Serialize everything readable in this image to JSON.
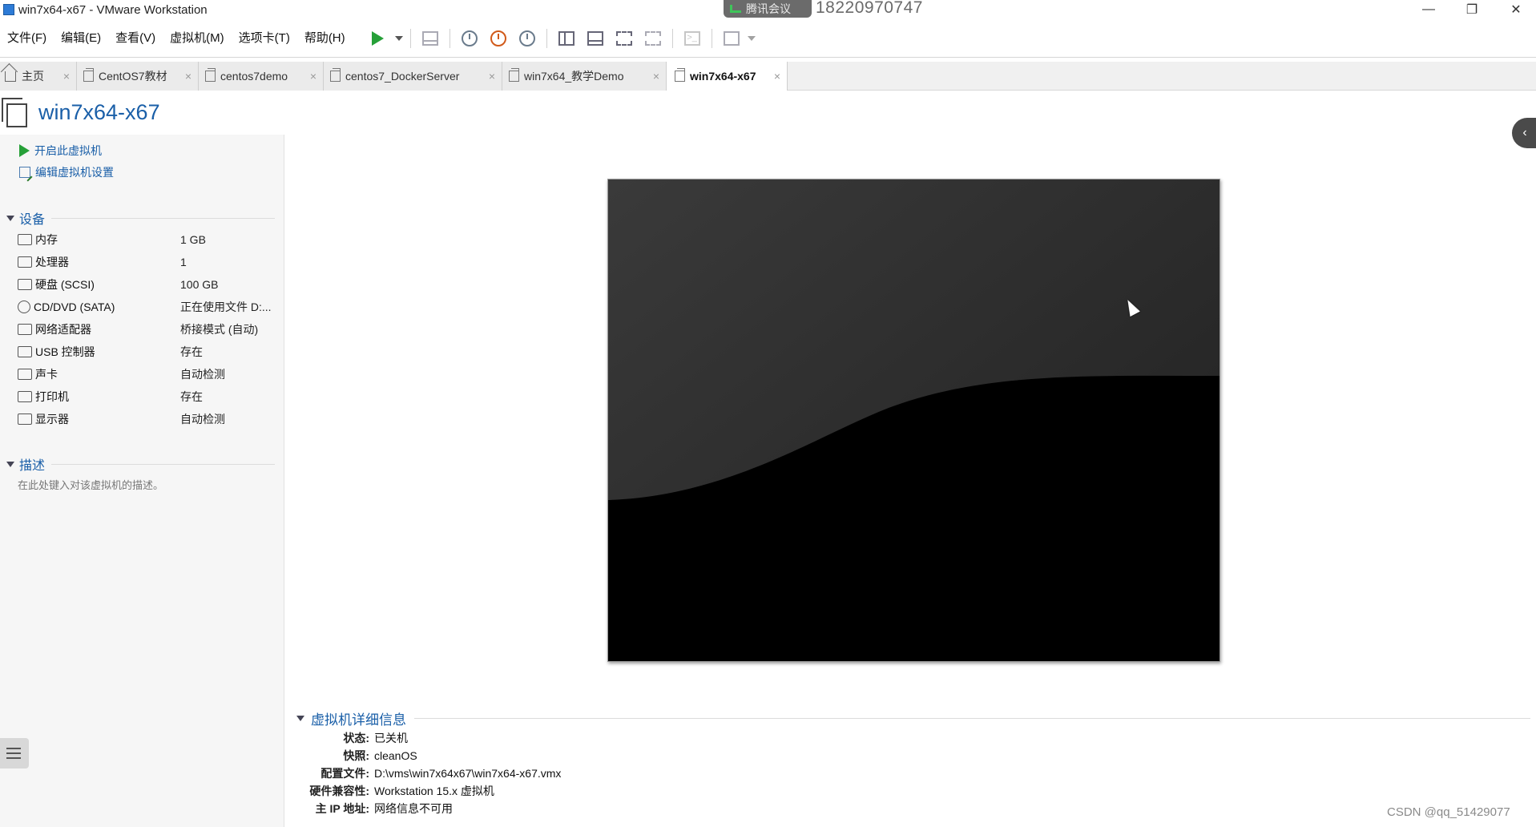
{
  "window": {
    "title": "win7x64-x67 - VMware Workstation",
    "meeting_badge": "腾讯会议",
    "meeting_number": "18220970747",
    "minimize": "—",
    "restore": "❐",
    "close": "✕"
  },
  "menu": [
    "文件(F)",
    "编辑(E)",
    "查看(V)",
    "虚拟机(M)",
    "选项卡(T)",
    "帮助(H)"
  ],
  "tabs": [
    {
      "label": "主页",
      "icon": "home-icon",
      "active": false
    },
    {
      "label": "CentOS7教材",
      "icon": "vm-icon",
      "active": false
    },
    {
      "label": "centos7demo",
      "icon": "vm-icon",
      "active": false
    },
    {
      "label": "centos7_DockerServer",
      "icon": "vm-icon",
      "active": false
    },
    {
      "label": "win7x64_教学Demo",
      "icon": "vm-icon",
      "active": false
    },
    {
      "label": "win7x64-x67",
      "icon": "vm-icon",
      "active": true
    }
  ],
  "tab_close": "×",
  "vm": {
    "title": "win7x64-x67",
    "actions": {
      "power_on": "开启此虚拟机",
      "edit_settings": "编辑虚拟机设置"
    }
  },
  "devices": {
    "heading": "设备",
    "items": [
      {
        "name": "内存",
        "value": "1 GB",
        "icon": "memory-icon"
      },
      {
        "name": "处理器",
        "value": "1",
        "icon": "cpu-icon"
      },
      {
        "name": "硬盘 (SCSI)",
        "value": "100 GB",
        "icon": "hard-disk-icon"
      },
      {
        "name": "CD/DVD (SATA)",
        "value": "正在使用文件 D:...",
        "icon": "cd-dvd-icon"
      },
      {
        "name": "网络适配器",
        "value": "桥接模式 (自动)",
        "icon": "network-adapter-icon"
      },
      {
        "name": "USB 控制器",
        "value": "存在",
        "icon": "usb-icon"
      },
      {
        "name": "声卡",
        "value": "自动检测",
        "icon": "sound-card-icon"
      },
      {
        "name": "打印机",
        "value": "存在",
        "icon": "printer-icon"
      },
      {
        "name": "显示器",
        "value": "自动检测",
        "icon": "display-icon"
      }
    ]
  },
  "description": {
    "heading": "描述",
    "placeholder": "在此处键入对该虚拟机的描述。"
  },
  "details": {
    "heading": "虚拟机详细信息",
    "rows": [
      {
        "label": "状态:",
        "value": "已关机"
      },
      {
        "label": "快照:",
        "value": "cleanOS"
      },
      {
        "label": "配置文件:",
        "value": "D:\\vms\\win7x64x67\\win7x64-x67.vmx"
      },
      {
        "label": "硬件兼容性:",
        "value": "Workstation 15.x 虚拟机"
      },
      {
        "label": "主 IP 地址:",
        "value": "网络信息不可用"
      }
    ]
  },
  "colors": {
    "accent": "#1a5fa8",
    "play_green": "#26a038",
    "screen_bg": "#000000"
  },
  "watermark": "CSDN @qq_51429077"
}
